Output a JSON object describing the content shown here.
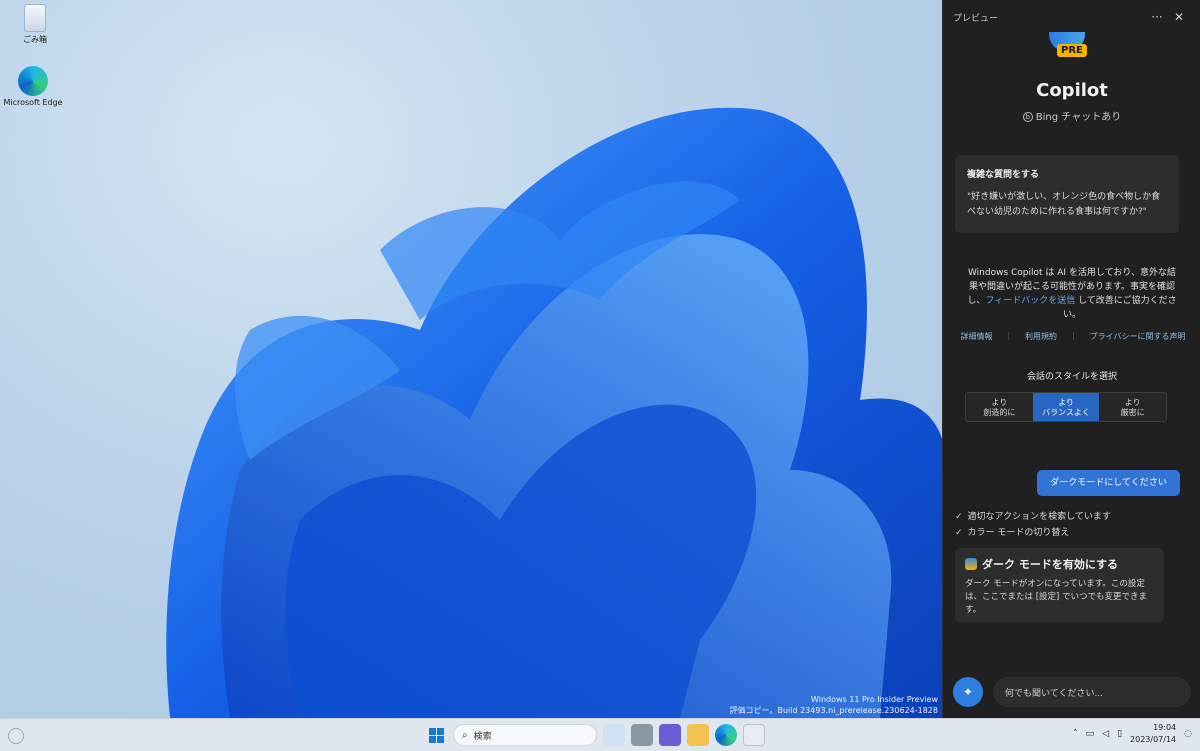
{
  "desktop": {
    "icons": [
      {
        "label": "ごみ箱"
      },
      {
        "label": "Microsoft Edge"
      }
    ],
    "watermark": {
      "line1": "Windows 11 Pro Insider Preview",
      "line2": "評価コピー。Build 23493.ni_prerelease.230624-1828"
    }
  },
  "panel": {
    "header_title": "プレビュー",
    "more_label": "···",
    "close_label": "✕",
    "logo_badge": "PRE",
    "app_title": "Copilot",
    "subtitle": "Bing チャットあり",
    "suggestion_card": {
      "heading": "複雑な質問をする",
      "question": "\"好き嫌いが激しい、オレンジ色の食べ物しか食べない幼児のために作れる食事は何ですか?\""
    },
    "disclaimer": {
      "before": "Windows Copilot は AI を活用しており、意外な結果や間違いが起こる可能性があります。事実を確認し、",
      "link": "フィードバックを送信",
      "after": " して改善にご協力ください。"
    },
    "links": [
      "詳細情報",
      "利用規約",
      "プライバシーに関する声明"
    ],
    "style_label": "会話のスタイルを選択",
    "styles": [
      {
        "line1": "より",
        "line2": "創造的に"
      },
      {
        "line1": "より",
        "line2": "バランスよく"
      },
      {
        "line1": "より",
        "line2": "厳密に"
      }
    ],
    "user_message": "ダークモードにしてください",
    "status_items": [
      "適切なアクションを検索しています",
      "カラー モードの切り替え"
    ],
    "action_card": {
      "title": "ダーク モードを有効にする",
      "body": "ダーク モードがオンになっています。この設定は、ここでまたは [設定] でいつでも変更できます。"
    },
    "input_placeholder": "何でも聞いてください..."
  },
  "taskbar": {
    "search_label": "検索",
    "time": "19:04",
    "date": "2023/07/14"
  },
  "colors": {
    "panel_bg": "#202020",
    "accent": "#3273d8",
    "link": "#62a8ea"
  }
}
